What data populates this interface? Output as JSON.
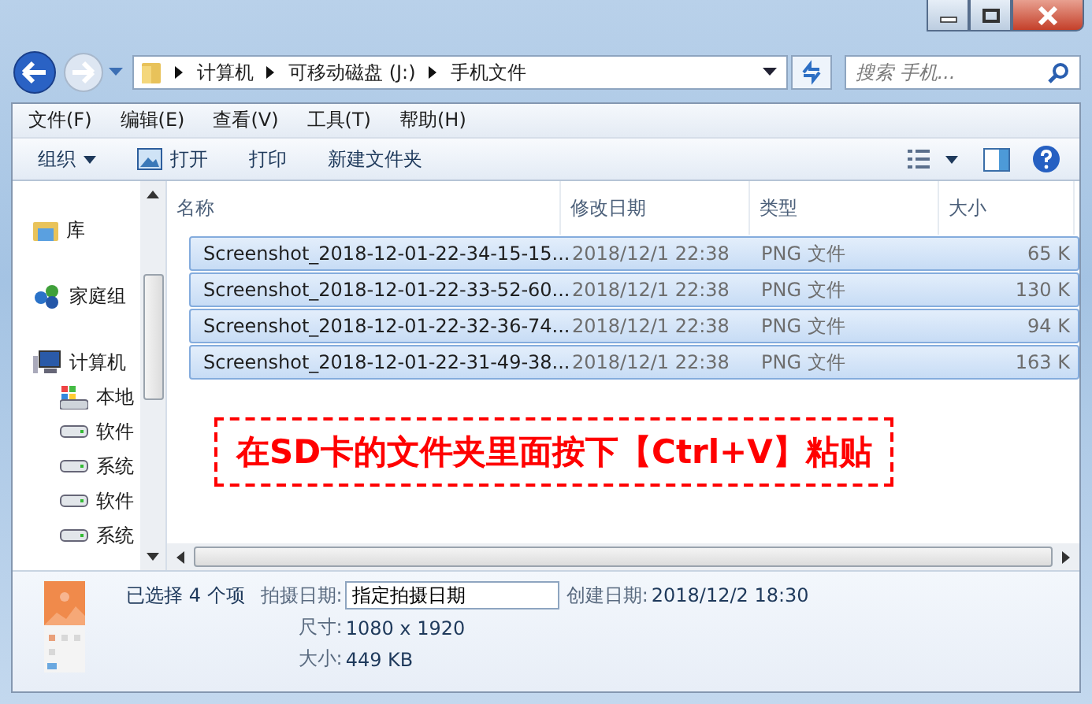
{
  "address": {
    "segments": [
      "计算机",
      "可移动磁盘 (J:)",
      "手机文件"
    ]
  },
  "search": {
    "placeholder": "搜索 手机..."
  },
  "menu": [
    "文件(F)",
    "编辑(E)",
    "查看(V)",
    "工具(T)",
    "帮助(H)"
  ],
  "toolbar": [
    {
      "label": "组织",
      "kind": "dropdown"
    },
    {
      "label": "打开",
      "kind": "open"
    },
    {
      "label": "打印",
      "kind": "plain"
    },
    {
      "label": "新建文件夹",
      "kind": "plain"
    }
  ],
  "sidebar": {
    "items": [
      {
        "label": "库",
        "kind": "library"
      },
      {
        "label": "家庭组",
        "kind": "homegroup"
      },
      {
        "label": "计算机",
        "kind": "computer",
        "children": [
          {
            "label": "本地",
            "kind": "system-drive"
          },
          {
            "label": "软件",
            "kind": "drive"
          },
          {
            "label": "系统",
            "kind": "drive"
          },
          {
            "label": "软件",
            "kind": "drive"
          },
          {
            "label": "系统",
            "kind": "drive"
          }
        ]
      }
    ]
  },
  "table": {
    "columns": [
      "名称",
      "修改日期",
      "类型",
      "大小"
    ],
    "rows": [
      {
        "name": "Screenshot_2018-12-01-22-34-15-15...",
        "modified": "2018/12/1 22:38",
        "type": "PNG 文件",
        "size": "65 K",
        "selected": true
      },
      {
        "name": "Screenshot_2018-12-01-22-33-52-60...",
        "modified": "2018/12/1 22:38",
        "type": "PNG 文件",
        "size": "130 K",
        "selected": true
      },
      {
        "name": "Screenshot_2018-12-01-22-32-36-74...",
        "modified": "2018/12/1 22:38",
        "type": "PNG 文件",
        "size": "94 K",
        "selected": true
      },
      {
        "name": "Screenshot_2018-12-01-22-31-49-38...",
        "modified": "2018/12/1 22:38",
        "type": "PNG 文件",
        "size": "163 K",
        "selected": true
      }
    ]
  },
  "annotation": {
    "text": "在SD卡的文件夹里面按下【Ctrl+V】粘贴"
  },
  "details": {
    "summary": "已选择 4 个项",
    "fields": [
      {
        "label": "拍摄日期:",
        "value": "指定拍摄日期",
        "kind": "input"
      },
      {
        "label": "创建日期:",
        "value": "2018/12/2 18:30",
        "kind": "text"
      },
      {
        "label": "尺寸:",
        "value": "1080 x 1920",
        "kind": "text"
      },
      {
        "label": "大小:",
        "value": "449 KB",
        "kind": "text"
      }
    ]
  }
}
